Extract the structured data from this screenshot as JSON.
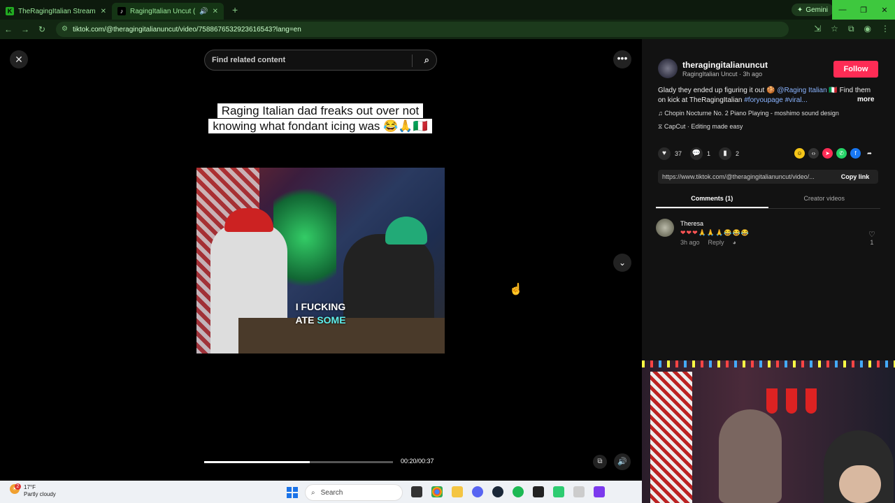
{
  "browser": {
    "tabs": [
      {
        "title": "TheRagingItalian Stream - Wat"
      },
      {
        "title": "RagingItalian Uncut (@theragingitalianuncut)"
      }
    ],
    "gemini_label": "Gemini",
    "url": "tiktok.com/@theragingitalianuncut/video/7588676532923616543?lang=en"
  },
  "video": {
    "search_placeholder": "Find related content",
    "caption": "Raging Italian dad freaks out over not knowing what fondant icing was 😂🙏🇮🇹",
    "subtitle_prefix": "I FUCKING",
    "subtitle_plain": "ATE ",
    "subtitle_highlight": "SOME",
    "time": "00:20/00:37",
    "progress": 0.56
  },
  "post": {
    "username": "theragingitalianuncut",
    "sub": "RagingItalian Uncut · 3h ago",
    "follow_label": "Follow",
    "desc_text": "Glady they ended up figuring it out 🍪 ",
    "desc_mention": "@Raging Italian 🇮🇹",
    "desc_text2": " Find them on kick at TheRagingItalian ",
    "desc_tags": "#foryoupage #viral...",
    "more_label": "more",
    "music": "♫  Chopin Nocturne No. 2 Piano Playing - moshimo sound design",
    "capcut": "CapCut · Editing made easy",
    "likes": "37",
    "comments": "1",
    "saves": "2",
    "share_url": "https://www.tiktok.com/@theragingitalianuncut/video/...",
    "copy_label": "Copy link"
  },
  "tabs": {
    "comments": "Comments (1)",
    "creator": "Creator videos"
  },
  "comment": {
    "name": "Theresa",
    "text": "❤❤❤🙏🙏🙏😂😂😂",
    "time": "3h ago",
    "reply": "Reply",
    "likes": "1"
  },
  "taskbar": {
    "temp": "17°F",
    "weather": "Partly cloudy",
    "weather_badge": "2",
    "search": "Search"
  }
}
